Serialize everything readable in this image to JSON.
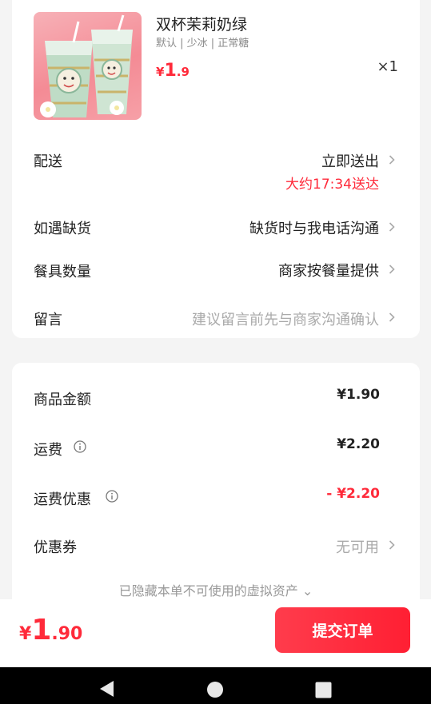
{
  "product": {
    "name": "双杯茉莉奶绿",
    "spec": "默认 | 少冰 | 正常糖",
    "price_currency": "¥",
    "price_int": "1",
    "price_dec": ".9",
    "qty": "×1"
  },
  "options": {
    "delivery": {
      "label": "配送",
      "value": "立即送出",
      "eta": "大约17:34送达"
    },
    "out_of_stock": {
      "label": "如遇缺货",
      "value": "缺货时与我电话沟通"
    },
    "utensils": {
      "label": "餐具数量",
      "value": "商家按餐量提供"
    },
    "note": {
      "label": "留言",
      "placeholder": "建议留言前先与商家沟通确认"
    }
  },
  "summary": {
    "goods": {
      "label": "商品金额",
      "value": "¥1.90"
    },
    "shipping": {
      "label": "运费",
      "value": "¥2.20"
    },
    "shipping_discount": {
      "label": "运费优惠",
      "value": "- ¥2.20"
    },
    "coupon": {
      "label": "优惠券",
      "value": "无可用"
    },
    "hidden_assets": "已隐藏本单不可使用的虚拟资产 ⌄"
  },
  "checkout": {
    "total_currency": "¥",
    "total_int": "1",
    "total_dec": ".90",
    "submit_label": "提交订单"
  },
  "colors": {
    "accent": "#ff2a3a",
    "background": "#f4f4f4"
  }
}
